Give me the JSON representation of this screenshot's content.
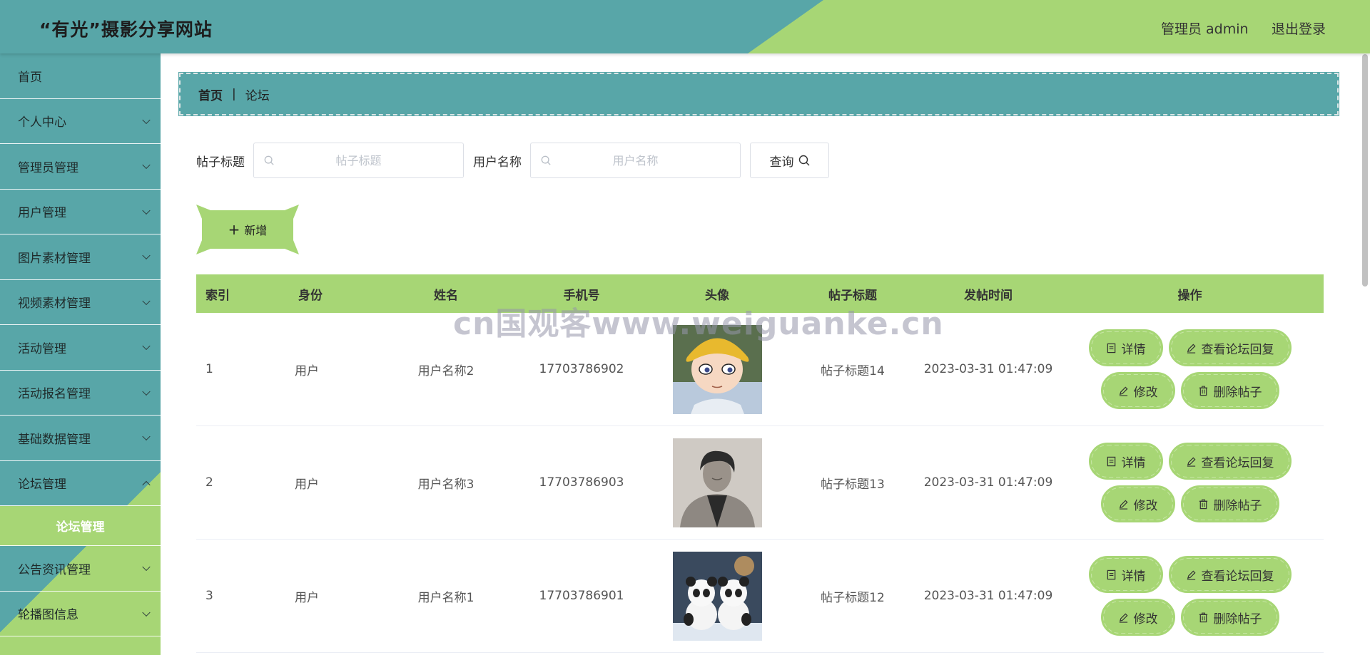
{
  "header": {
    "title": "“有光”摄影分享网站",
    "user_label": "管理员 admin",
    "logout_label": "退出登录"
  },
  "sidebar": {
    "items": [
      {
        "label": "首页",
        "has_arrow": false
      },
      {
        "label": "个人中心",
        "has_arrow": true
      },
      {
        "label": "管理员管理",
        "has_arrow": true
      },
      {
        "label": "用户管理",
        "has_arrow": true
      },
      {
        "label": "图片素材管理",
        "has_arrow": true
      },
      {
        "label": "视频素材管理",
        "has_arrow": true
      },
      {
        "label": "活动管理",
        "has_arrow": true
      },
      {
        "label": "活动报名管理",
        "has_arrow": true
      },
      {
        "label": "基础数据管理",
        "has_arrow": true
      },
      {
        "label": "论坛管理",
        "has_arrow": true,
        "open": true
      },
      {
        "label": "公告资讯管理",
        "has_arrow": true
      },
      {
        "label": "轮播图信息",
        "has_arrow": true
      }
    ],
    "active_sub": "论坛管理"
  },
  "breadcrumb": {
    "home": "首页",
    "separator": "|",
    "current": "论坛"
  },
  "search": {
    "title_label": "帖子标题",
    "title_placeholder": "帖子标题",
    "title_value": "",
    "user_label": "用户名称",
    "user_placeholder": "用户名称",
    "user_value": "",
    "query_label": "查询"
  },
  "add_label": "新增",
  "table": {
    "columns": [
      "索引",
      "身份",
      "姓名",
      "手机号",
      "头像",
      "帖子标题",
      "发帖时间",
      "操作"
    ],
    "rows": [
      {
        "index": "1",
        "role": "用户",
        "name": "用户名称2",
        "phone": "17703786902",
        "avatar": "cartoon-boy-yellow-hat",
        "post_title": "帖子标题14",
        "time": "2023-03-31 01:47:09"
      },
      {
        "index": "2",
        "role": "用户",
        "name": "用户名称3",
        "phone": "17703786903",
        "avatar": "man-black-white-photo",
        "post_title": "帖子标题13",
        "time": "2023-03-31 01:47:09"
      },
      {
        "index": "3",
        "role": "用户",
        "name": "用户名称1",
        "phone": "17703786901",
        "avatar": "two-pandas-snow",
        "post_title": "帖子标题12",
        "time": "2023-03-31 01:47:09"
      }
    ],
    "actions": {
      "detail": "详情",
      "view_replies": "查看论坛回复",
      "edit": "修改",
      "delete": "删除帖子"
    }
  },
  "watermark": "cn国观客www.weiguanke.cn",
  "colors": {
    "teal": "#58a6a8",
    "green": "#a7d675"
  }
}
